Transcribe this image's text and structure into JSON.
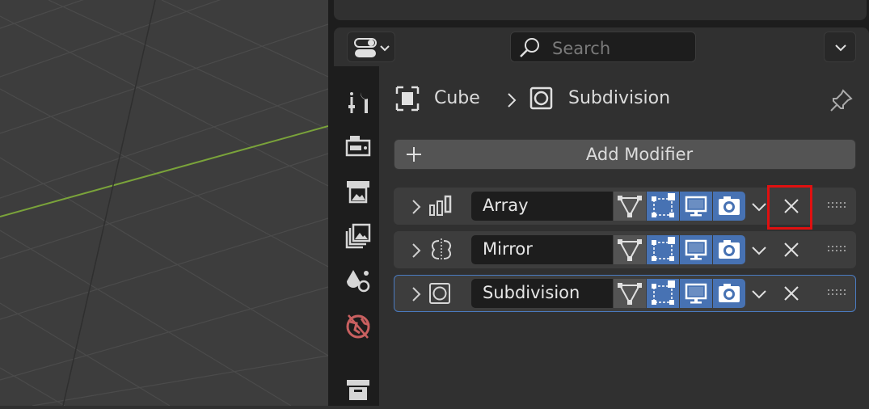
{
  "header": {
    "search": {
      "placeholder": "Search",
      "icon": "search-icon"
    },
    "editor_type_icon": "toggle-icon",
    "options_icon": "chevron-down-icon"
  },
  "tabs": [
    {
      "name": "tool",
      "icon": "tool-icon"
    },
    {
      "name": "render",
      "icon": "render-icon"
    },
    {
      "name": "output",
      "icon": "output-icon"
    },
    {
      "name": "view-layer",
      "icon": "view-layer-icon"
    },
    {
      "name": "scene",
      "icon": "scene-icon"
    },
    {
      "name": "world",
      "icon": "world-icon"
    },
    {
      "name": "collection",
      "icon": "collection-icon"
    }
  ],
  "breadcrumb": {
    "object": "Cube",
    "separator": ">",
    "modifier": "Subdivision"
  },
  "add_modifier": {
    "label": "Add Modifier",
    "icon": "plus-icon"
  },
  "modifiers": [
    {
      "name": "Array",
      "icon": "array-modifier-icon",
      "active": false,
      "edit_mode": false,
      "on_cage": true,
      "viewport": true,
      "render": true
    },
    {
      "name": "Mirror",
      "icon": "mirror-modifier-icon",
      "active": false,
      "edit_mode": false,
      "on_cage": true,
      "viewport": true,
      "render": true
    },
    {
      "name": "Subdivision",
      "icon": "subdivision-modifier-icon",
      "active": true,
      "edit_mode": false,
      "on_cage": true,
      "viewport": true,
      "render": true
    }
  ],
  "colors": {
    "accent": "#4772b3",
    "panel": "#303030",
    "row": "#3d3d3d",
    "field": "#1d1d1d",
    "highlight": "#e01010",
    "grid_x_axis": "#7aa33a"
  }
}
